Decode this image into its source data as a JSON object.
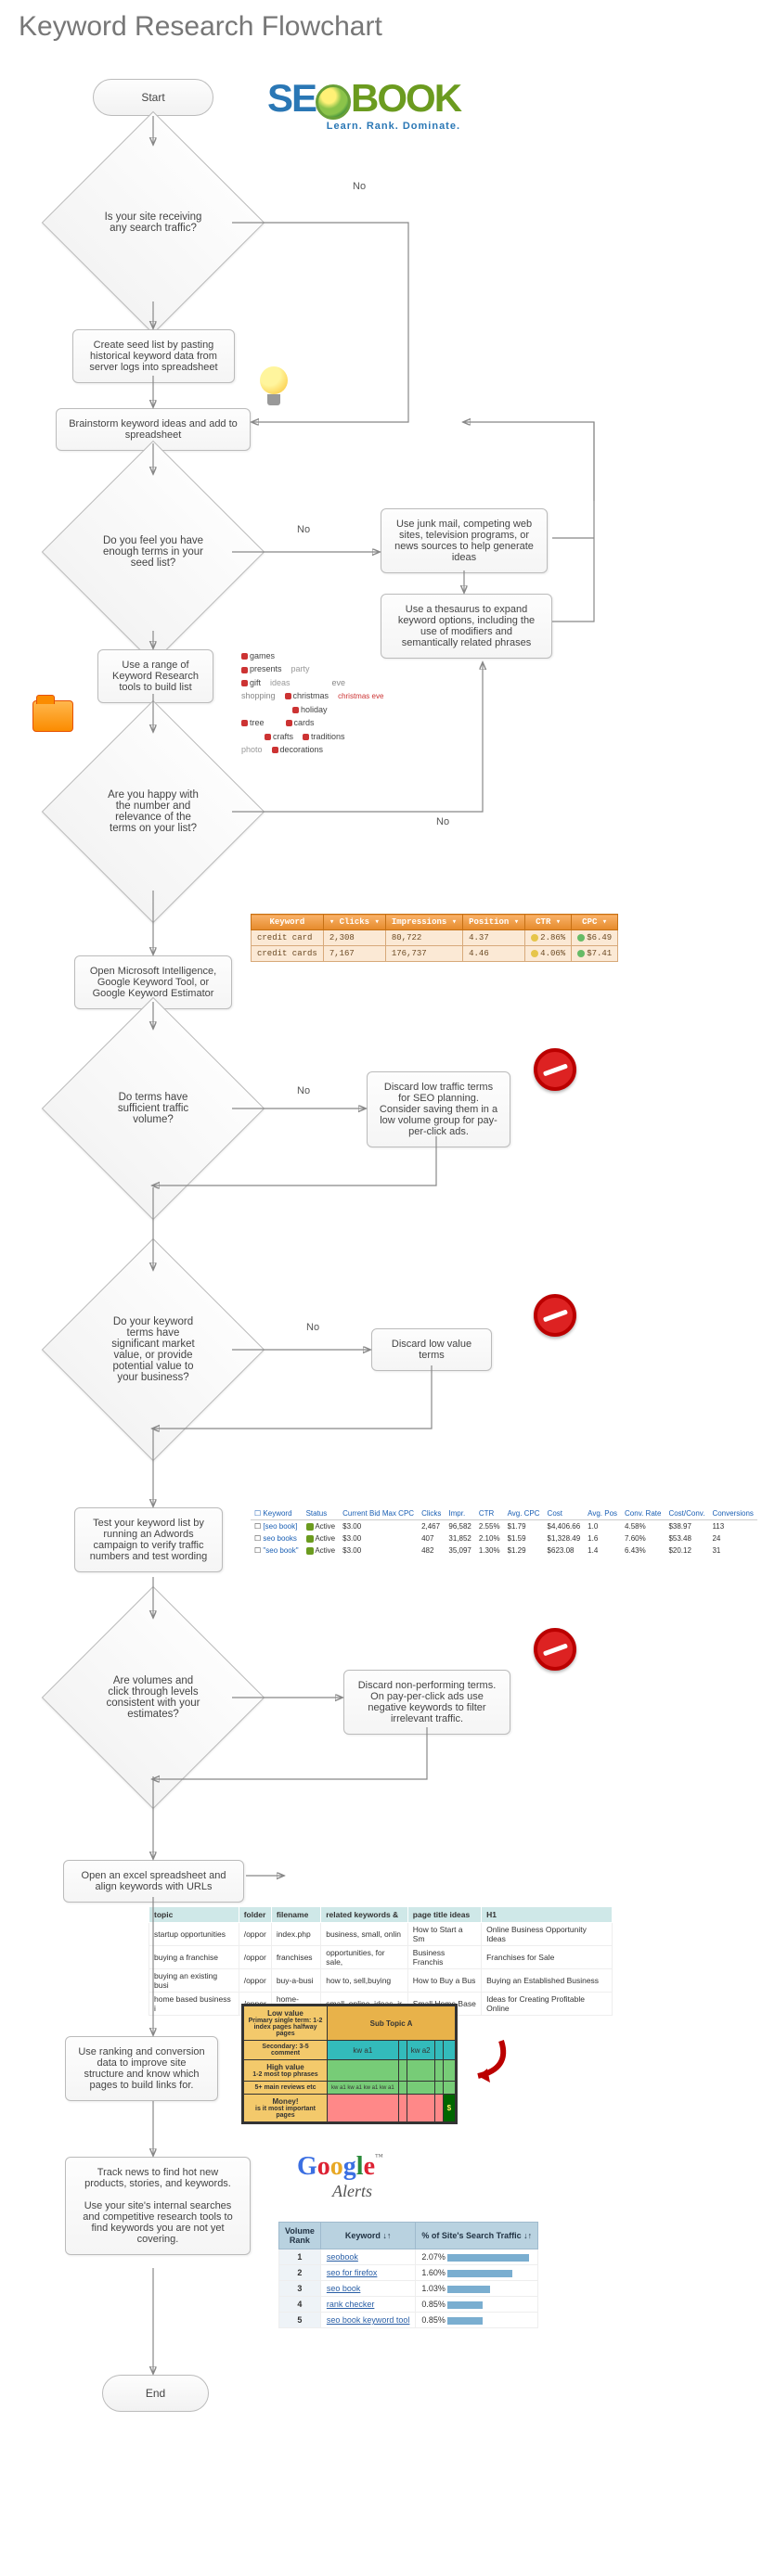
{
  "title": "Keyword Research Flowchart",
  "logo": {
    "tagline": "Learn. Rank. Dominate."
  },
  "nodes": {
    "start": "Start",
    "end": "End",
    "d1": "Is your site receiving any search traffic?",
    "p1": "Create seed list by pasting historical keyword data from server logs into spreadsheet",
    "p2": "Brainstorm keyword ideas and add to spreadsheet",
    "d2": "Do you feel you have enough terms in your seed list?",
    "s2a": "Use junk mail, competing web sites, television programs, or news sources to help generate ideas",
    "s2b": "Use a thesaurus to expand keyword options, including the use of modifiers and semantically related phrases",
    "p3": "Use a range of Keyword Research tools to build list",
    "d3": "Are you happy with the number and relevance of the terms on your list?",
    "p4": "Open Microsoft Intelligence, Google Keyword Tool, or Google Keyword Estimator",
    "d4": "Do terms have sufficient traffic volume?",
    "s4": "Discard low traffic terms for SEO planning. Consider saving them in a low volume group for pay-per-click ads.",
    "d5": "Do your keyword terms have significant market value, or provide potential value to your business?",
    "s5": "Discard low value terms",
    "p5": "Test your keyword list by running an Adwords campaign to verify traffic numbers and test wording",
    "d6": "Are volumes and click through levels consistent with your estimates?",
    "s6": "Discard non-performing terms. On pay-per-click ads use negative keywords to filter irrelevant traffic.",
    "p6": "Open an excel spreadsheet and align keywords with URLs",
    "p7": "Use ranking and conversion data to improve site structure and know which pages to build links for.",
    "p8a": "Track news to find hot new products, stories, and keywords.",
    "p8b": "Use your site's internal searches and competitive research tools to find keywords you are not yet covering."
  },
  "labels": {
    "no": "No"
  },
  "cloud": [
    {
      "c": "#c33",
      "t": "games"
    },
    {
      "c": "#c33",
      "t": "presents"
    },
    {
      "c": "#999",
      "t": "party"
    },
    {
      "c": "#c33",
      "t": "gift"
    },
    {
      "c": "#999",
      "t": "ideas"
    },
    {
      "c": "#888",
      "t": "eve"
    },
    {
      "c": "#888",
      "t": "shopping"
    },
    {
      "c": "#c33",
      "t": "christmas"
    },
    {
      "c": "#c33",
      "t": "christmas eve"
    },
    {
      "c": "#c33",
      "t": "holiday"
    },
    {
      "c": "#c33",
      "t": "tree"
    },
    {
      "c": "#c33",
      "t": "cards"
    },
    {
      "c": "#c33",
      "t": "crafts"
    },
    {
      "c": "#c33",
      "t": "traditions"
    },
    {
      "c": "#999",
      "t": "photo"
    },
    {
      "c": "#c33",
      "t": "decorations"
    }
  ],
  "metrics": {
    "headers": [
      "Keyword",
      "Clicks",
      "Impressions",
      "Position",
      "CTR",
      "CPC"
    ],
    "rows": [
      {
        "kw": "credit card",
        "clicks": "2,308",
        "imp": "80,722",
        "pos": "4.37",
        "ctr": "2.86%",
        "ctr_c": "#e6c54a",
        "cpc": "$6.49"
      },
      {
        "kw": "credit cards",
        "clicks": "7,167",
        "imp": "176,737",
        "pos": "4.46",
        "ctr": "4.06%",
        "ctr_c": "#e6c54a",
        "cpc": "$7.41"
      }
    ]
  },
  "adwords": {
    "headers": [
      "Keyword",
      "Status",
      "Current Bid Max CPC",
      "Clicks",
      "Impr.",
      "CTR",
      "Avg. CPC",
      "Cost",
      "Avg. Pos",
      "Conv. Rate",
      "Cost/Conv.",
      "Conversions"
    ],
    "rows": [
      {
        "kw": "[seo book]",
        "st": "Active",
        "bid": "$3.00",
        "cl": "2,467",
        "imp": "96,582",
        "ctr": "2.55%",
        "acp": "$1.79",
        "cost": "$4,406.66",
        "pos": "1.0",
        "cr": "4.58%",
        "cc": "$38.97",
        "cv": "113"
      },
      {
        "kw": "seo books",
        "st": "Active",
        "bid": "$3.00",
        "cl": "407",
        "imp": "31,852",
        "ctr": "2.10%",
        "acp": "$1.59",
        "cost": "$1,328.49",
        "pos": "1.6",
        "cr": "7.60%",
        "cc": "$53.48",
        "cv": "24"
      },
      {
        "kw": "\"seo book\"",
        "st": "Active",
        "bid": "$3.00",
        "cl": "482",
        "imp": "35,097",
        "ctr": "1.30%",
        "acp": "$1.29",
        "cost": "$623.08",
        "pos": "1.4",
        "cr": "6.43%",
        "cc": "$20.12",
        "cv": "31"
      }
    ]
  },
  "excel": {
    "headers": [
      "topic",
      "folder",
      "filename",
      "related keywords &",
      "page title ideas",
      "H1"
    ],
    "rows": [
      [
        "startup opportunities",
        "/oppor",
        "index.php",
        "business, small, onlin",
        "How to Start a Sm",
        "Online Business Opportunity Ideas"
      ],
      [
        "buying a franchise",
        "/oppor",
        "franchises",
        "opportunities, for sale,",
        "Business Franchis",
        "Franchises for Sale"
      ],
      [
        "buying an existing busi",
        "/oppor",
        "buy-a-busi",
        "how to, sell,buying",
        "How to Buy a Bus",
        "Buying an Established Business"
      ],
      [
        "home based business i",
        "/oppor",
        "home-base",
        "small, online, ideas, ir",
        "Small Home Base",
        "Ideas for Creating Profitable Online"
      ]
    ]
  },
  "subtopic": {
    "title": "Sub Topic A",
    "rows": [
      {
        "label": "Low value",
        "sub": "Primary single term: 1-2 index pages halfway pages",
        "cls": "row-low",
        "cells": [
          "",
          "",
          "",
          "",
          ""
        ]
      },
      {
        "label": "",
        "sub": "Secondary: 3-5 comment",
        "cls": "row-low",
        "cells": [
          "kw a1",
          "",
          "kw a2",
          "",
          ""
        ]
      },
      {
        "label": "High value",
        "sub": "1-2 most top phrases",
        "cls": "row-high",
        "cells": [
          "",
          "",
          "",
          "",
          ""
        ]
      },
      {
        "label": "",
        "sub": "5+ main reviews etc",
        "cls": "row-high",
        "cells": [
          "kw a1 kw a1 kw a1 kw a1",
          "",
          "",
          "",
          ""
        ]
      },
      {
        "label": "Money!",
        "sub": "is it most important pages",
        "cls": "row-money",
        "cells": [
          "",
          "",
          "",
          "",
          "$"
        ]
      }
    ]
  },
  "traffic": {
    "headers": [
      "Volume Rank",
      "Keyword ↓↑",
      "% of Site's Search Traffic ↓↑"
    ],
    "rows": [
      {
        "r": "1",
        "kw": "seobook",
        "pct": "2.07%",
        "w": 88
      },
      {
        "r": "2",
        "kw": "seo for firefox",
        "pct": "1.60%",
        "w": 70
      },
      {
        "r": "3",
        "kw": "seo book",
        "pct": "1.03%",
        "w": 46
      },
      {
        "r": "4",
        "kw": "rank checker",
        "pct": "0.85%",
        "w": 38
      },
      {
        "r": "5",
        "kw": "seo book keyword tool",
        "pct": "0.85%",
        "w": 38
      }
    ]
  },
  "google_alerts": "Alerts"
}
